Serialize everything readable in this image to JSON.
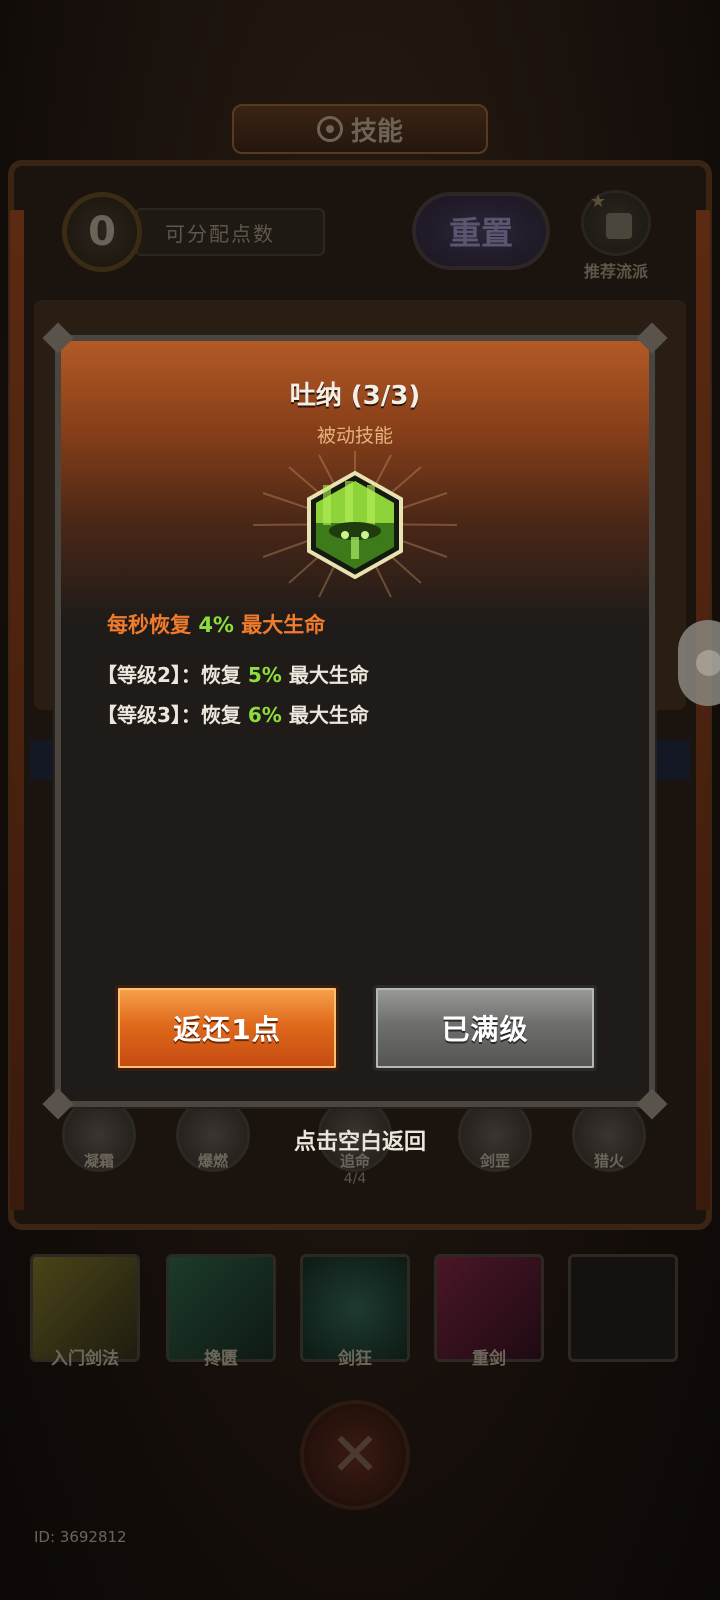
{
  "background": {
    "title": "技能",
    "points": "0",
    "points_label": "可分配点数",
    "reset_label": "重置",
    "recommend_label": "推荐流派",
    "skill_nodes": [
      {
        "name": "凝霜",
        "count": ""
      },
      {
        "name": "爆燃",
        "count": ""
      },
      {
        "name": "追命",
        "count": "4/4"
      },
      {
        "name": "剑罡",
        "count": ""
      },
      {
        "name": "猎火",
        "count": ""
      }
    ],
    "bottom_skills": [
      {
        "name": "入门剑法"
      },
      {
        "name": "搀匮"
      },
      {
        "name": "剑狂"
      },
      {
        "name": "重剑"
      },
      {
        "name": ""
      }
    ],
    "player_id": "ID: 3692812"
  },
  "modal": {
    "skill_name": "吐纳 (3/3)",
    "skill_type": "被动技能",
    "effect_prefix": "每秒恢复 ",
    "effect_value": "4%",
    "effect_suffix": " 最大生命",
    "levels": [
      {
        "prefix": "【等级2】：恢复 ",
        "value": "5%",
        "suffix": " 最大生命"
      },
      {
        "prefix": "【等级3】：恢复 ",
        "value": "6%",
        "suffix": " 最大生命"
      }
    ],
    "return_button": "返还1点",
    "max_button": "已满级"
  },
  "tap_hint": "点击空白返回",
  "colors": {
    "orange_text": "#f07b2c",
    "green_value": "#8dde3b",
    "return_btn": "#e06a1c",
    "max_btn": "#6e6e6c"
  },
  "icons": [
    "film-reel-icon",
    "thumb-up-icon",
    "skill-hex-icon",
    "crossed-swords-icon"
  ]
}
